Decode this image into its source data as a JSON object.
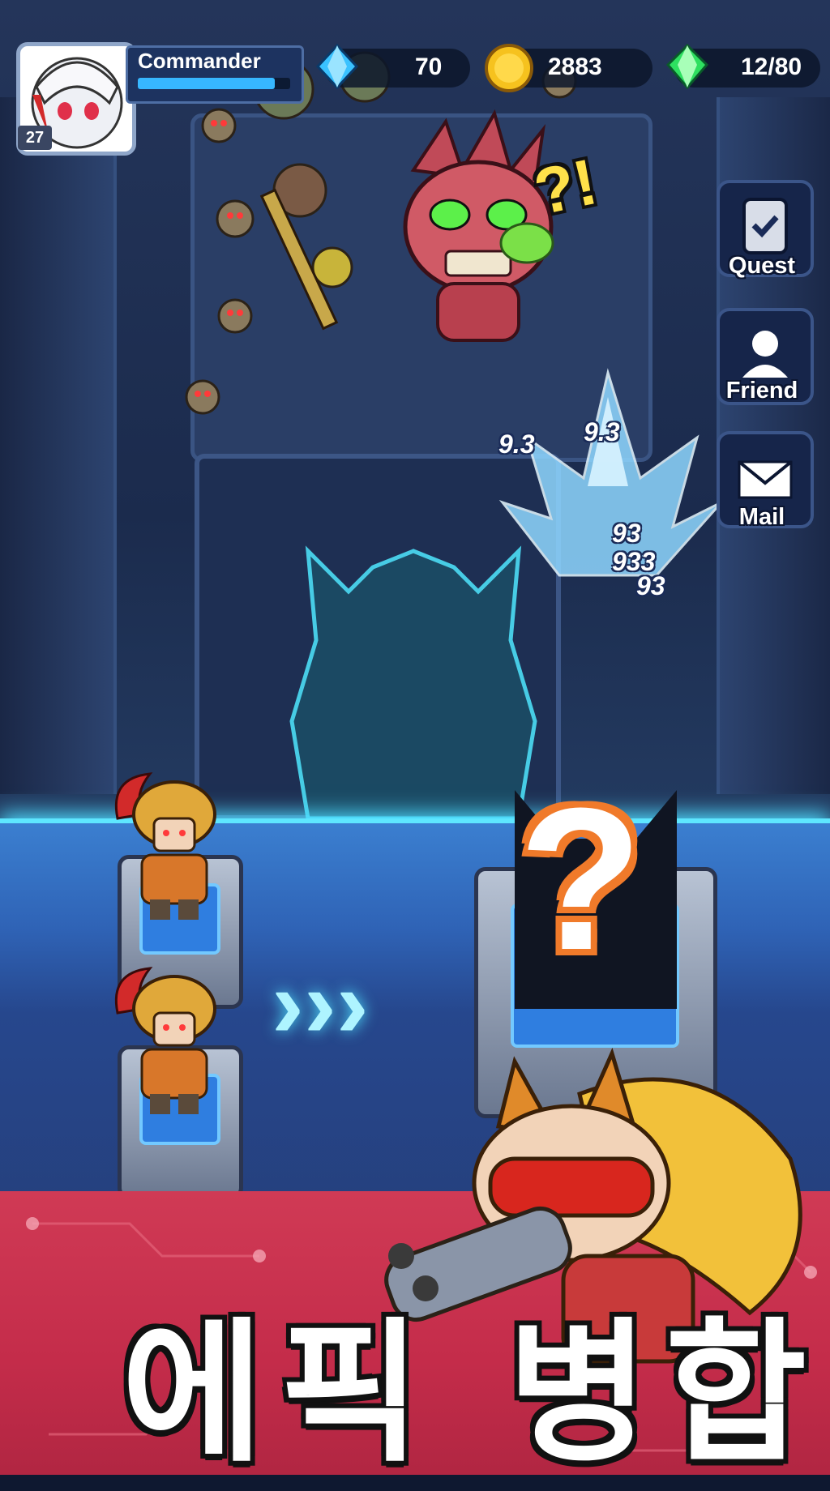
{
  "player": {
    "name": "Commander",
    "level": "27",
    "xp_fraction": 0.9
  },
  "resources": [
    {
      "icon": "blue-diamond-icon",
      "value": "70"
    },
    {
      "icon": "gold-coin-icon",
      "value": "2883"
    },
    {
      "icon": "green-gem-icon",
      "value": "12/80"
    }
  ],
  "side_menu": [
    {
      "icon": "quest-clipboard-icon",
      "label": "Quest"
    },
    {
      "icon": "friend-person-icon",
      "label": "Friend"
    },
    {
      "icon": "mail-envelope-icon",
      "label": "Mail"
    }
  ],
  "boss_exclaim": "?!",
  "damage_numbers": [
    "9.3",
    "9.3",
    "93",
    "933",
    "93"
  ],
  "merge": {
    "result_symbol": "?",
    "arrows": "›››"
  },
  "banner": {
    "title": "에픽 병합"
  },
  "colors": {
    "accent_cyan": "#5ee6ff",
    "banner_red": "#c42c4a",
    "platform_blue": "#2f63b6"
  }
}
